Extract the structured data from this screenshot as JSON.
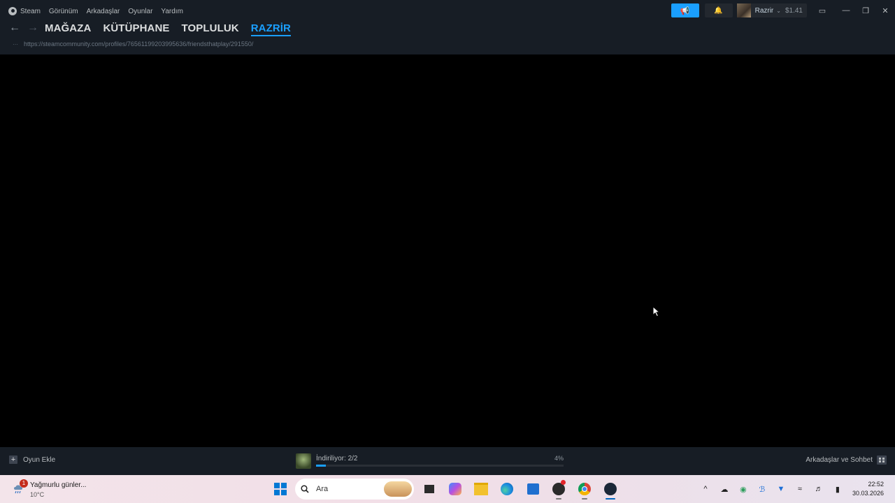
{
  "menu": {
    "app": "Steam",
    "items": [
      "Görünüm",
      "Arkadaşlar",
      "Oyunlar",
      "Yardım"
    ]
  },
  "nav": {
    "tabs": [
      "MAĞAZA",
      "KÜTÜPHANE",
      "TOPLULUK",
      "RAZRİR"
    ],
    "active_tab": "RAZRİR"
  },
  "url": "https://steamcommunity.com/profiles/76561199203995636/friendsthatplay/291550/",
  "account": {
    "username": "Razrir",
    "wallet": "$1.41"
  },
  "bottom": {
    "add_game": "Oyun Ekle",
    "download_status": "İndiriliyor: 2/2",
    "download_percent_label": "4%",
    "download_progress": 0.04,
    "friends_chat": "Arkadaşlar ve Sohbet"
  },
  "taskbar": {
    "weather_title": "Yağmurlu günler...",
    "weather_temp": "10°C",
    "weather_badge": "1",
    "search_placeholder": "Ara",
    "time": "22:52",
    "date": "30.03.2026"
  },
  "colors": {
    "accent": "#1a9fff",
    "titlebar": "#171d25",
    "content_bg": "#000000"
  },
  "icons": [
    "steam-icon",
    "back-arrow-icon",
    "forward-arrow-icon",
    "megaphone-icon",
    "bell-icon",
    "big-picture-icon",
    "minimize-icon",
    "restore-icon",
    "close-icon",
    "plus-icon",
    "friends-grid-icon",
    "windows-start-icon",
    "search-icon",
    "file-explorer-icon",
    "edge-icon",
    "store-icon",
    "chrome-icon",
    "steam-taskbar-icon"
  ]
}
